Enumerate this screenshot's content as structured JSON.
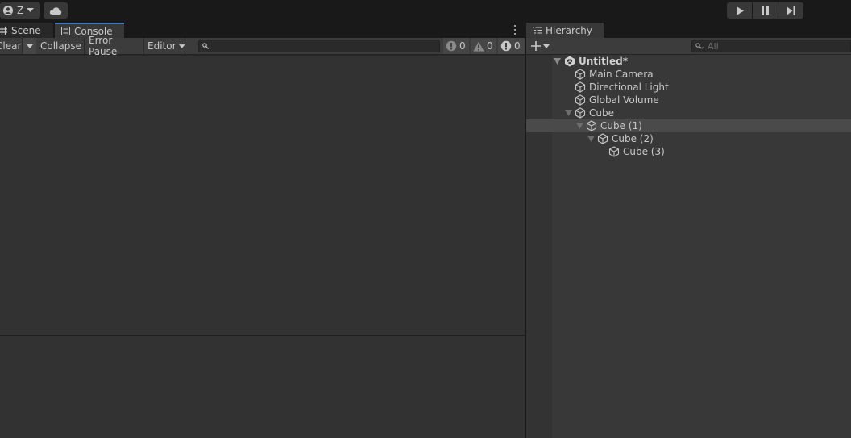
{
  "topbar": {
    "account_letter": "Z",
    "icons": [
      "account-icon",
      "chevron-down-icon",
      "cloud-icon",
      "play-icon",
      "pause-icon",
      "step-icon"
    ]
  },
  "console_panel": {
    "tabs": [
      {
        "label": "Scene",
        "icon": "grid-icon",
        "active": false
      },
      {
        "label": "Console",
        "icon": "console-icon",
        "active": true
      }
    ],
    "toolbar": {
      "clear_label": "Clear",
      "collapse_label": "Collapse",
      "error_pause_label": "Error Pause",
      "editor_label": "Editor",
      "search_placeholder": "",
      "info_count": "0",
      "warning_count": "0",
      "error_count": "0"
    }
  },
  "hierarchy_panel": {
    "tab_label": "Hierarchy",
    "search_placeholder": "All",
    "items": [
      {
        "label": "Untitled*",
        "kind": "scene",
        "expanded": true
      },
      {
        "label": "Main Camera",
        "kind": "object"
      },
      {
        "label": "Directional Light",
        "kind": "object"
      },
      {
        "label": "Global Volume",
        "kind": "object"
      },
      {
        "label": "Cube",
        "kind": "object",
        "expanded": true
      },
      {
        "label": "Cube (1)",
        "kind": "object",
        "expanded": true,
        "selected": true
      },
      {
        "label": "Cube (2)",
        "kind": "object",
        "expanded": true
      },
      {
        "label": "Cube (3)",
        "kind": "object"
      }
    ]
  },
  "colors": {
    "background": "#191919",
    "panel": "#383838",
    "toolbar": "#3c3c3c",
    "console_area": "#323232",
    "active_tab_accent": "#3a79bb",
    "text": "#c8c8c8",
    "selected_row": "#4a4a4a"
  }
}
